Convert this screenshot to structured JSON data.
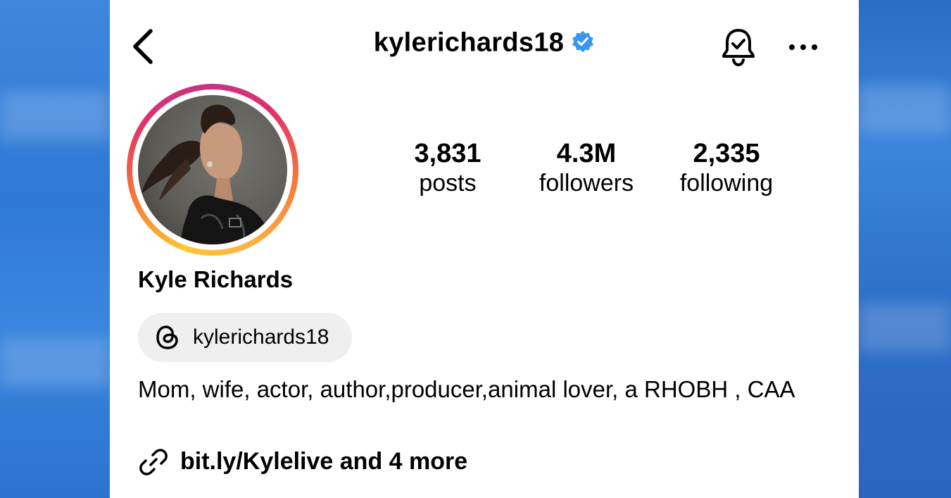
{
  "header": {
    "username": "kylerichards18",
    "verified": true,
    "accent_color": "#3897f0"
  },
  "icons": {
    "back": "chevron-left-icon",
    "verified": "verified-badge-icon",
    "notifications": "bell-check-icon",
    "more": "ellipsis-icon",
    "threads": "threads-icon",
    "link": "link-icon"
  },
  "profile": {
    "display_name": "Kyle Richards",
    "avatar": "profile-photo"
  },
  "stats": [
    {
      "value": "3,831",
      "label": "posts"
    },
    {
      "value": "4.3M",
      "label": "followers"
    },
    {
      "value": "2,335",
      "label": "following"
    }
  ],
  "threads": {
    "handle": "kylerichards18"
  },
  "bio": {
    "text": "Mom, wife, actor, author,producer,animal lover, a RHOBH , CAA"
  },
  "link": {
    "text": "bit.ly/Kylelive and 4 more"
  },
  "colors": {
    "background_blue": "#2f74cf",
    "chip_gray": "#efefef",
    "story_ring": [
      "#fdc830",
      "#f77737",
      "#e1306c",
      "#c13584"
    ]
  }
}
